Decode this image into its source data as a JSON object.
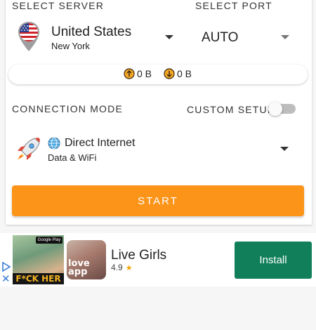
{
  "server": {
    "section_label": "SELECT SERVER",
    "country": "United States",
    "city": "New York",
    "flag_icon": "us-flag-pin-icon"
  },
  "port": {
    "section_label": "SELECT PORT",
    "value": "AUTO"
  },
  "traffic": {
    "upload": "0 B",
    "download": "0 B"
  },
  "connection": {
    "section_label": "CONNECTION MODE",
    "custom_setup_label": "CUSTOM SETUP",
    "custom_setup_enabled": false,
    "mode_title": "Direct Internet",
    "mode_subtitle": "Data & WiFi"
  },
  "start_label": "START",
  "ad": {
    "image_badge": "Google Play",
    "image_caption": "F*CK HER",
    "app_icon_text": "love app",
    "title": "Live Girls",
    "rating": "4.9",
    "install_label": "Install"
  },
  "colors": {
    "accent": "#fb9419",
    "install": "#11805a",
    "toggle_off": "#bdbdbd"
  }
}
